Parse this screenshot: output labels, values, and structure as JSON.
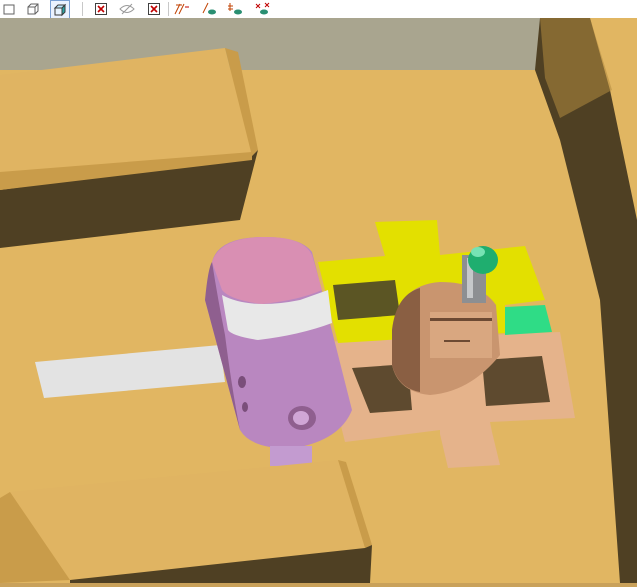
{
  "toolbar": {
    "buttons": [
      {
        "icon": "view-front-icon"
      },
      {
        "icon": "view-iso-wire-icon"
      },
      {
        "icon": "view-iso-shaded-icon",
        "active": true
      },
      {
        "icon": "hide-x-box-icon"
      },
      {
        "icon": "eye-hidden-icon"
      },
      {
        "icon": "close-x-box-icon"
      },
      {
        "icon": "show-edges-icon"
      },
      {
        "icon": "show-axis-eye-icon"
      },
      {
        "icon": "show-dims-eye-icon"
      },
      {
        "icon": "hide-dims-eye-icon"
      }
    ]
  },
  "colors": {
    "table": "#e1b662",
    "table_shadow": "#4f4023",
    "background": "#a9a58f",
    "clamp": "#d98fb3",
    "clamp_band": "#e8e8e8",
    "clamp_lower": "#b987c0",
    "rail": "#e3e3e3",
    "vise_base": "#e5b38b",
    "vise_slot": "#5e4a2f",
    "yellow_plate": "#e3e000",
    "green_insert": "#2fdc86",
    "tool": "#1fae6f"
  }
}
